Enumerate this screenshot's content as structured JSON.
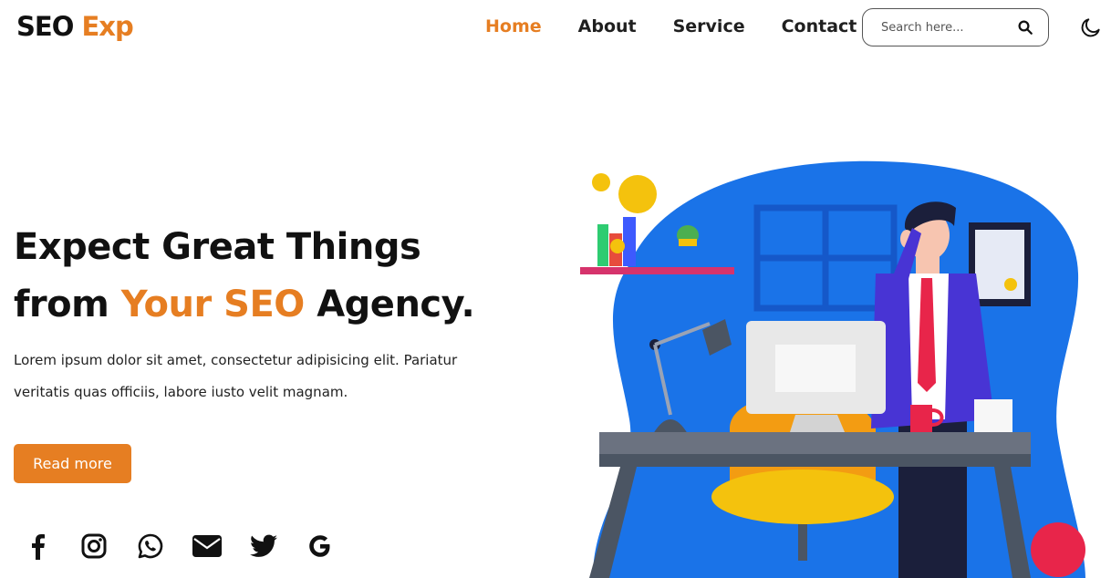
{
  "header": {
    "logo": {
      "part1": "SEO",
      "part2": "Exp"
    },
    "nav": [
      {
        "label": "Home",
        "active": true
      },
      {
        "label": "About",
        "active": false
      },
      {
        "label": "Service",
        "active": false
      },
      {
        "label": "Contact",
        "active": false
      }
    ],
    "search": {
      "placeholder": "Search here...",
      "icon": "search-icon"
    },
    "theme_toggle_icon": "moon-icon"
  },
  "hero": {
    "headline_line1": "Expect Great Things",
    "headline_line2_prefix": "from",
    "headline_line2_accent": "Your SEO",
    "headline_line2_suffix": "Agency.",
    "description_line1": "Lorem ipsum dolor sit amet, consectetur adipisicing elit. Pariatur",
    "description_line2": "veritatis quas officiis, labore iusto velit magnam.",
    "cta_label": "Read more",
    "illustration_icon": "businessman-office-illustration"
  },
  "socials": [
    {
      "icon": "facebook-icon"
    },
    {
      "icon": "instagram-icon"
    },
    {
      "icon": "whatsapp-icon"
    },
    {
      "icon": "email-icon"
    },
    {
      "icon": "twitter-icon"
    },
    {
      "icon": "google-icon"
    }
  ],
  "colors": {
    "accent": "#e67e22",
    "text": "#111111",
    "illustration_blue": "#1a73e8"
  }
}
